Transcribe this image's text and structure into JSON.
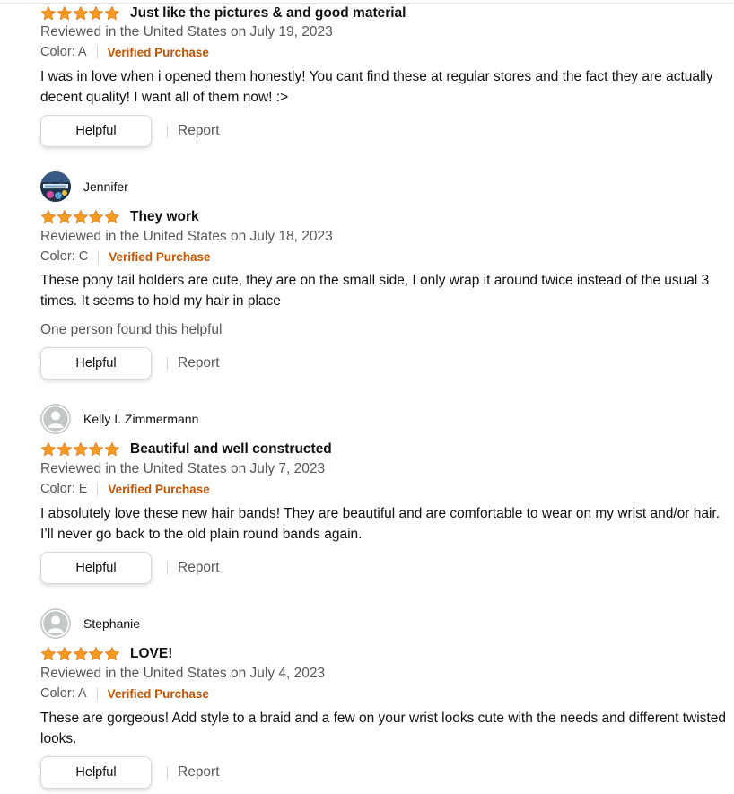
{
  "colors": {
    "star": "#f79c1f",
    "verified": "#c45500",
    "secondary_text": "#565959",
    "primary_text": "#0f1111",
    "divider": "#d5d9d9"
  },
  "reviews": [
    {
      "reviewer": "",
      "avatar": "none",
      "rating": 5,
      "title": "Just like the pictures & and good material",
      "date": "Reviewed in the United States on July 19, 2023",
      "variant": "Color: A",
      "verified": "Verified Purchase",
      "body": "I was in love when i opened them honestly! You cant find these at regular stores and the fact they are actually decent quality! I want all of them now! :>",
      "helpful_count": "",
      "helpful_label": "Helpful",
      "report_label": "Report"
    },
    {
      "reviewer": "Jennifer",
      "avatar": "photo-avatar",
      "rating": 5,
      "title": "They work",
      "date": "Reviewed in the United States on July 18, 2023",
      "variant": "Color: C",
      "verified": "Verified Purchase",
      "body": "These pony tail holders are cute, they are on the small side, I only wrap it around twice instead of the usual 3 times. It seems to hold my hair in place",
      "helpful_count": "One person found this helpful",
      "helpful_label": "Helpful",
      "report_label": "Report"
    },
    {
      "reviewer": "Kelly I. Zimmermann",
      "avatar": "default-avatar",
      "rating": 5,
      "title": "Beautiful and well constructed",
      "date": "Reviewed in the United States on July 7, 2023",
      "variant": "Color: E",
      "verified": "Verified Purchase",
      "body": "I absolutely love these new hair bands! They are beautiful and are comfortable to wear on my wrist and/or hair. I’ll never go back to the old plain round bands again.",
      "helpful_count": "",
      "helpful_label": "Helpful",
      "report_label": "Report"
    },
    {
      "reviewer": "Stephanie",
      "avatar": "default-avatar",
      "rating": 5,
      "title": "LOVE!",
      "date": "Reviewed in the United States on July 4, 2023",
      "variant": "Color: A",
      "verified": "Verified Purchase",
      "body": "These are gorgeous! Add style to a braid and a few on your wrist looks cute with the needs and different twisted looks.",
      "helpful_count": "",
      "helpful_label": "Helpful",
      "report_label": "Report"
    }
  ]
}
